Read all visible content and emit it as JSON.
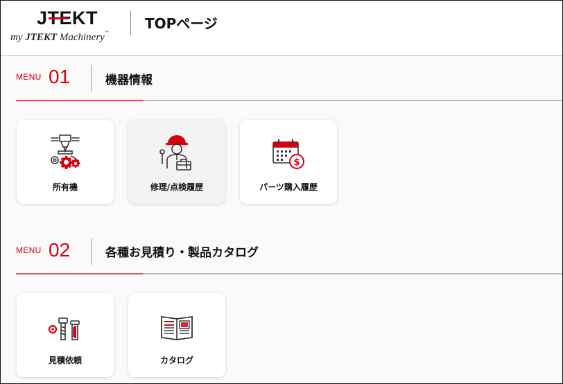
{
  "header": {
    "logo_main": "JTEKT",
    "logo_sub_prefix": "my ",
    "logo_sub_brand": "JTEKT",
    "logo_sub_suffix": " Machinery",
    "logo_tm": "™",
    "page_title": "TOPページ"
  },
  "sections": [
    {
      "menu_label": "MENU",
      "menu_number": "01",
      "title": "機器情報",
      "cards": [
        {
          "label": "所有機",
          "icon": "machine-gear-icon"
        },
        {
          "label": "修理/点検履歴",
          "icon": "repair-worker-icon"
        },
        {
          "label": "パーツ購入履歴",
          "icon": "calendar-dollar-icon"
        }
      ]
    },
    {
      "menu_label": "MENU",
      "menu_number": "02",
      "title": "各種お見積り・製品カタログ",
      "cards": [
        {
          "label": "見積依頼",
          "icon": "bolts-nut-icon"
        },
        {
          "label": "カタログ",
          "icon": "catalog-book-icon"
        }
      ]
    }
  ],
  "colors": {
    "accent_red": "#d7000f",
    "text": "#111111",
    "card_bg": "#ffffff",
    "page_bg": "#fafafa"
  }
}
